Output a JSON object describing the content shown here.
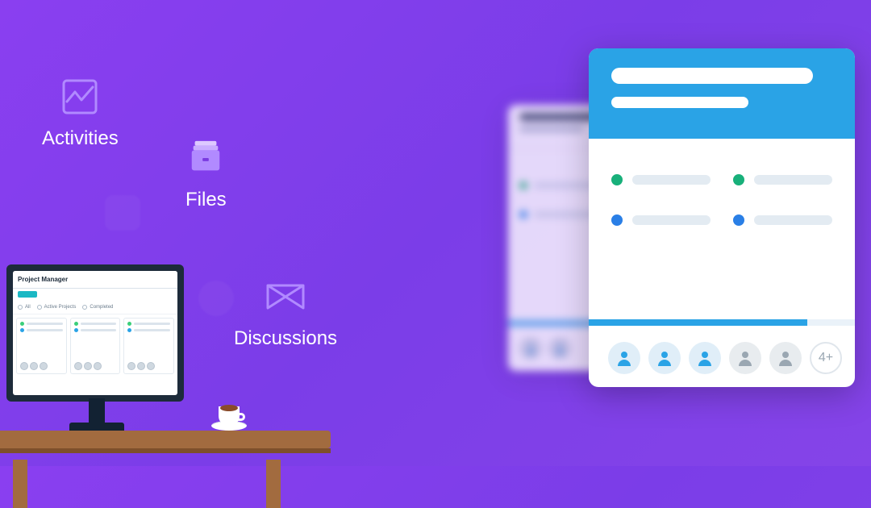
{
  "features": {
    "activities": {
      "label": "Activities"
    },
    "files": {
      "label": "Files"
    },
    "discussions": {
      "label": "Discussions"
    }
  },
  "monitor": {
    "title": "Project Manager",
    "tabs": [
      "All",
      "Active Projects",
      "Completed"
    ]
  },
  "front_card": {
    "extra_avatar_label": "4+"
  }
}
